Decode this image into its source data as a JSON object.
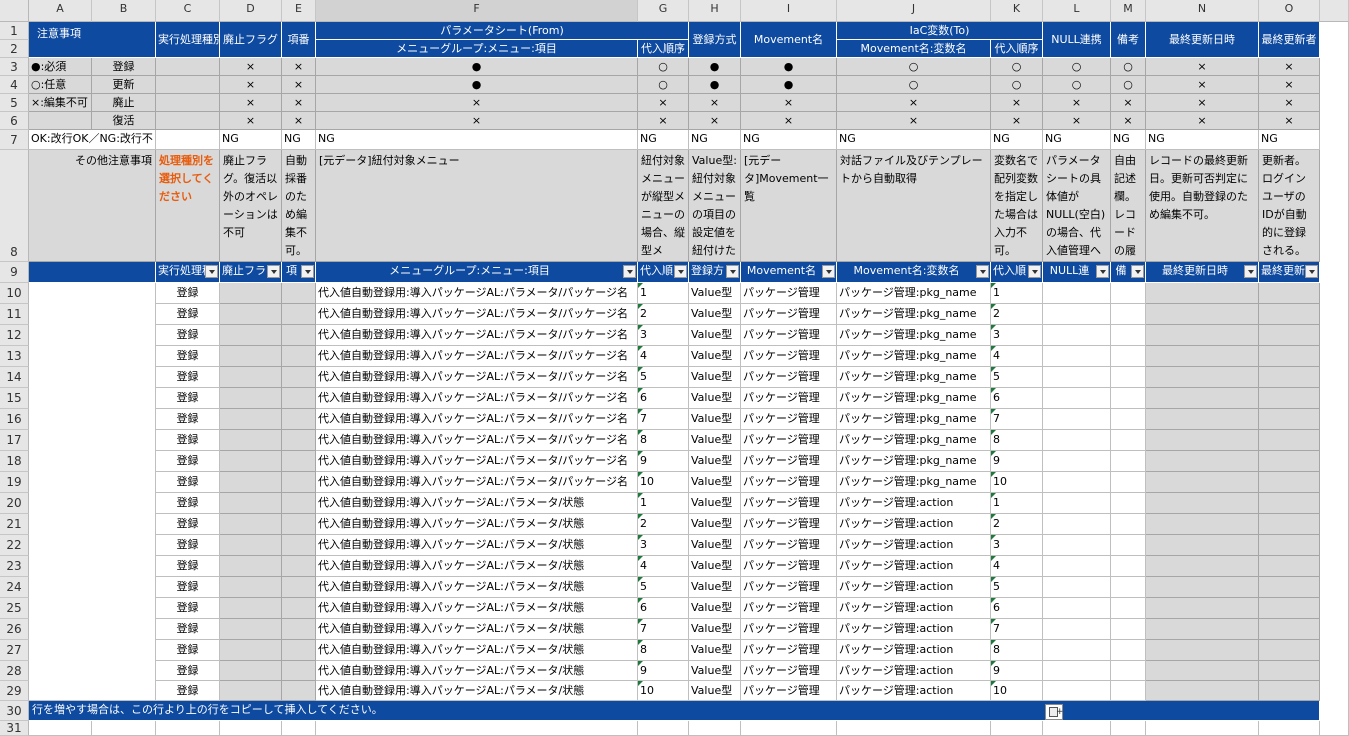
{
  "columns": [
    "A",
    "B",
    "C",
    "D",
    "E",
    "F",
    "G",
    "H",
    "I",
    "J",
    "K",
    "L",
    "M",
    "N",
    "O"
  ],
  "rows": [
    "1",
    "2",
    "3",
    "4",
    "5",
    "6",
    "7",
    "8",
    "9",
    "10",
    "11",
    "12",
    "13",
    "14",
    "15",
    "16",
    "17",
    "18",
    "19",
    "20",
    "21",
    "22",
    "23",
    "24",
    "25",
    "26",
    "27",
    "28",
    "29",
    "30",
    "31"
  ],
  "header": {
    "notes_title": "注意事項",
    "exec_type": "実行処理種別",
    "discard_flag": "廃止フラグ",
    "item_no": "項番",
    "param_from": "パラメータシート(From)",
    "menu_path": "メニューグループ:メニュー:項目",
    "assign_order": "代入順序",
    "reg_method": "登録方式",
    "movement": "Movement名",
    "iac_to": "IaC変数(To)",
    "movement_var": "Movement名:変数名",
    "assign_order_to": "代入順序",
    "null_link": "NULL連携",
    "remarks": "備考",
    "last_updated": "最終更新日時",
    "last_user": "最終更新者"
  },
  "legend": {
    "required": "●:必須",
    "optional": "○:任意",
    "noedit": "×:編集不可",
    "ops": [
      "登録",
      "更新",
      "廃止",
      "復活"
    ],
    "newline": "OK:改行OK／NG:改行不"
  },
  "marks": [
    [
      "",
      "×",
      "×",
      "●",
      "○",
      "●",
      "●",
      "○",
      "○",
      "○",
      "○",
      "×",
      "×"
    ],
    [
      "",
      "×",
      "×",
      "●",
      "○",
      "●",
      "●",
      "○",
      "○",
      "○",
      "○",
      "×",
      "×"
    ],
    [
      "",
      "×",
      "×",
      "×",
      "×",
      "×",
      "×",
      "×",
      "×",
      "×",
      "×",
      "×",
      "×"
    ],
    [
      "",
      "×",
      "×",
      "×",
      "×",
      "×",
      "×",
      "×",
      "×",
      "×",
      "×",
      "×",
      "×"
    ]
  ],
  "ng": [
    "",
    "NG",
    "NG",
    "NG",
    "NG",
    "NG",
    "NG",
    "NG",
    "NG",
    "NG",
    "NG",
    "NG",
    "NG"
  ],
  "notes": {
    "label": "その他注意事項",
    "exec": "処理種別を選択してください",
    "discard": "廃止フラグ。復活以外のオペレーションは不可",
    "item_no": "自動採番のため編集不可。実行",
    "menu": "[元データ]紐付対象メニュー",
    "order": "紐付対象メニューが縦型メニューの場合、縦型メ",
    "method": "Value型:紐付対象メニューの項目の設定値を紐付けた",
    "movement": "[元データ]Movement一覧",
    "var": "対話ファイル及びテンプレートから自動取得",
    "order_to": "変数名で配列変数を指定した場合は入力不可。",
    "null": "パラメータシートの具体値がNULL(空白)の場合、代入値管理へ登録",
    "remarks": "自由記述欄。レコードの履",
    "updated": "レコードの最終更新日。更新可否判定に使用。自動登録のため編集不可。",
    "user": "更新者。ログインユーザのIDが自動的に登録される。編集不可。"
  },
  "filter_headers": [
    "実行処理種",
    "廃止フラ",
    "項",
    "メニューグループ:メニュー:項目",
    "代入順",
    "登録方",
    "Movement名",
    "Movement名:変数名",
    "代入順",
    "NULL連",
    "備",
    "最終更新日時",
    "最終更新"
  ],
  "data_rows": [
    {
      "exec": "登録",
      "menu": "代入値自動登録用:導入パッケージAL:パラメータ/パッケージ名",
      "order": "1",
      "method": "Value型",
      "movement": "パッケージ管理",
      "var": "パッケージ管理:pkg_name",
      "order_to": "1"
    },
    {
      "exec": "登録",
      "menu": "代入値自動登録用:導入パッケージAL:パラメータ/パッケージ名",
      "order": "2",
      "method": "Value型",
      "movement": "パッケージ管理",
      "var": "パッケージ管理:pkg_name",
      "order_to": "2"
    },
    {
      "exec": "登録",
      "menu": "代入値自動登録用:導入パッケージAL:パラメータ/パッケージ名",
      "order": "3",
      "method": "Value型",
      "movement": "パッケージ管理",
      "var": "パッケージ管理:pkg_name",
      "order_to": "3"
    },
    {
      "exec": "登録",
      "menu": "代入値自動登録用:導入パッケージAL:パラメータ/パッケージ名",
      "order": "4",
      "method": "Value型",
      "movement": "パッケージ管理",
      "var": "パッケージ管理:pkg_name",
      "order_to": "4"
    },
    {
      "exec": "登録",
      "menu": "代入値自動登録用:導入パッケージAL:パラメータ/パッケージ名",
      "order": "5",
      "method": "Value型",
      "movement": "パッケージ管理",
      "var": "パッケージ管理:pkg_name",
      "order_to": "5"
    },
    {
      "exec": "登録",
      "menu": "代入値自動登録用:導入パッケージAL:パラメータ/パッケージ名",
      "order": "6",
      "method": "Value型",
      "movement": "パッケージ管理",
      "var": "パッケージ管理:pkg_name",
      "order_to": "6"
    },
    {
      "exec": "登録",
      "menu": "代入値自動登録用:導入パッケージAL:パラメータ/パッケージ名",
      "order": "7",
      "method": "Value型",
      "movement": "パッケージ管理",
      "var": "パッケージ管理:pkg_name",
      "order_to": "7"
    },
    {
      "exec": "登録",
      "menu": "代入値自動登録用:導入パッケージAL:パラメータ/パッケージ名",
      "order": "8",
      "method": "Value型",
      "movement": "パッケージ管理",
      "var": "パッケージ管理:pkg_name",
      "order_to": "8"
    },
    {
      "exec": "登録",
      "menu": "代入値自動登録用:導入パッケージAL:パラメータ/パッケージ名",
      "order": "9",
      "method": "Value型",
      "movement": "パッケージ管理",
      "var": "パッケージ管理:pkg_name",
      "order_to": "9"
    },
    {
      "exec": "登録",
      "menu": "代入値自動登録用:導入パッケージAL:パラメータ/パッケージ名",
      "order": "10",
      "method": "Value型",
      "movement": "パッケージ管理",
      "var": "パッケージ管理:pkg_name",
      "order_to": "10"
    },
    {
      "exec": "登録",
      "menu": "代入値自動登録用:導入パッケージAL:パラメータ/状態",
      "order": "1",
      "method": "Value型",
      "movement": "パッケージ管理",
      "var": "パッケージ管理:action",
      "order_to": "1"
    },
    {
      "exec": "登録",
      "menu": "代入値自動登録用:導入パッケージAL:パラメータ/状態",
      "order": "2",
      "method": "Value型",
      "movement": "パッケージ管理",
      "var": "パッケージ管理:action",
      "order_to": "2"
    },
    {
      "exec": "登録",
      "menu": "代入値自動登録用:導入パッケージAL:パラメータ/状態",
      "order": "3",
      "method": "Value型",
      "movement": "パッケージ管理",
      "var": "パッケージ管理:action",
      "order_to": "3"
    },
    {
      "exec": "登録",
      "menu": "代入値自動登録用:導入パッケージAL:パラメータ/状態",
      "order": "4",
      "method": "Value型",
      "movement": "パッケージ管理",
      "var": "パッケージ管理:action",
      "order_to": "4"
    },
    {
      "exec": "登録",
      "menu": "代入値自動登録用:導入パッケージAL:パラメータ/状態",
      "order": "5",
      "method": "Value型",
      "movement": "パッケージ管理",
      "var": "パッケージ管理:action",
      "order_to": "5"
    },
    {
      "exec": "登録",
      "menu": "代入値自動登録用:導入パッケージAL:パラメータ/状態",
      "order": "6",
      "method": "Value型",
      "movement": "パッケージ管理",
      "var": "パッケージ管理:action",
      "order_to": "6"
    },
    {
      "exec": "登録",
      "menu": "代入値自動登録用:導入パッケージAL:パラメータ/状態",
      "order": "7",
      "method": "Value型",
      "movement": "パッケージ管理",
      "var": "パッケージ管理:action",
      "order_to": "7"
    },
    {
      "exec": "登録",
      "menu": "代入値自動登録用:導入パッケージAL:パラメータ/状態",
      "order": "8",
      "method": "Value型",
      "movement": "パッケージ管理",
      "var": "パッケージ管理:action",
      "order_to": "8"
    },
    {
      "exec": "登録",
      "menu": "代入値自動登録用:導入パッケージAL:パラメータ/状態",
      "order": "9",
      "method": "Value型",
      "movement": "パッケージ管理",
      "var": "パッケージ管理:action",
      "order_to": "9"
    },
    {
      "exec": "登録",
      "menu": "代入値自動登録用:導入パッケージAL:パラメータ/状態",
      "order": "10",
      "method": "Value型",
      "movement": "パッケージ管理",
      "var": "パッケージ管理:action",
      "order_to": "10"
    }
  ],
  "footer_note": "行を増やす場合は、この行より上の行をコピーして挿入してください。",
  "colors": {
    "header_blue": "#0e4aa0",
    "gray": "#d9d9d9",
    "note_orange": "#e85c0d",
    "formula_green": "#1d7a3a"
  }
}
